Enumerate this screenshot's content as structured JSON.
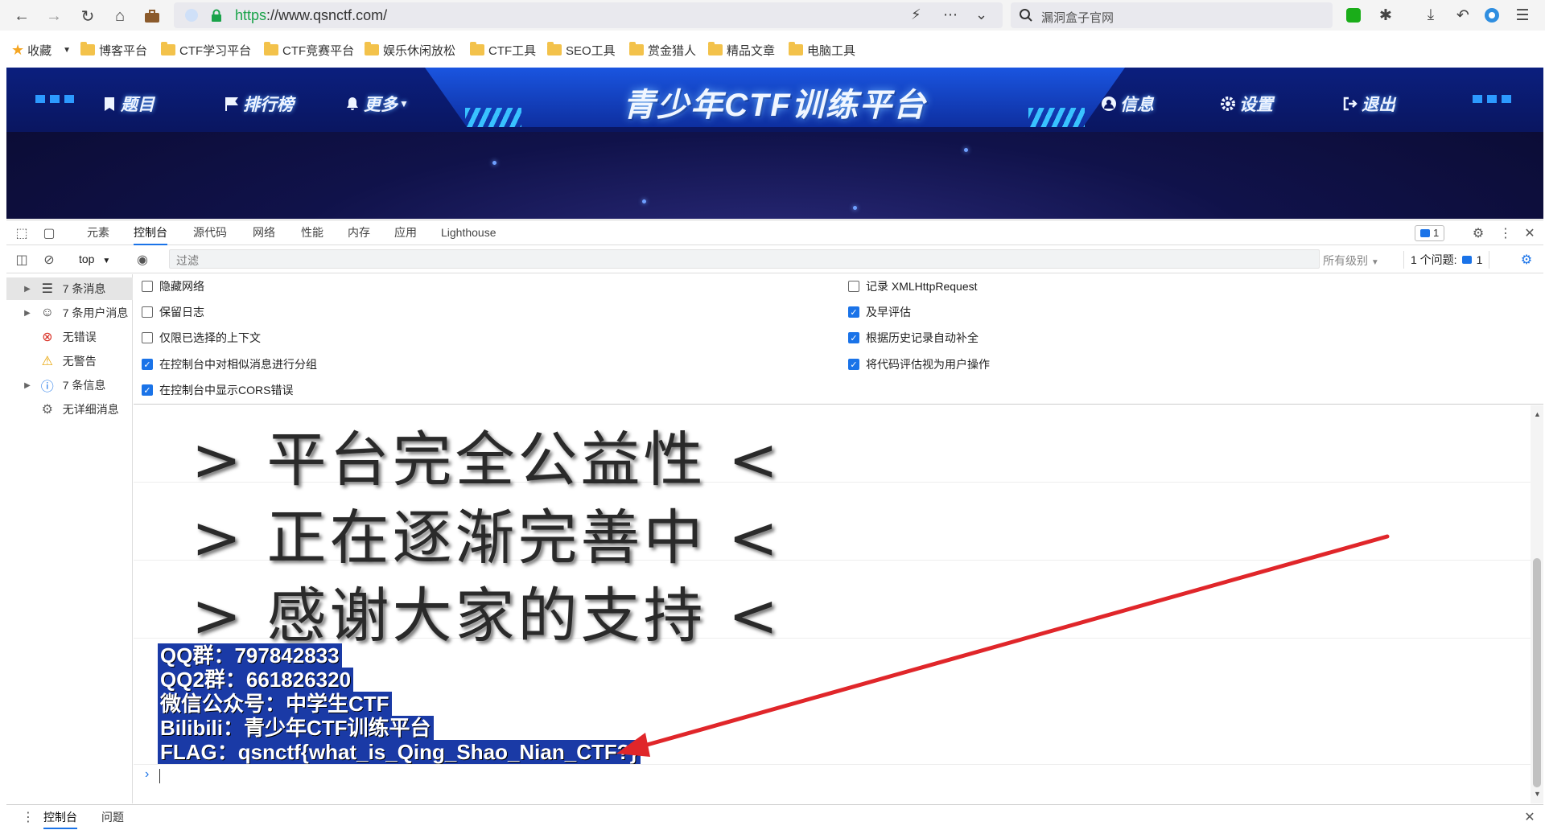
{
  "browser": {
    "url_protocol": "https",
    "url_rest": "://www.qsnctf.com/",
    "search_placeholder": "漏洞盒子官网"
  },
  "bookmarks": {
    "favorites_label": "收藏",
    "items": [
      "博客平台",
      "CTF学习平台",
      "CTF竞赛平台",
      "娱乐休闲放松",
      "CTF工具",
      "SEO工具",
      "赏金猎人",
      "精品文章",
      "电脑工具"
    ]
  },
  "site": {
    "title": "青少年CTF训练平台",
    "nav_left": [
      "题目",
      "排行榜",
      "更多"
    ],
    "nav_right": [
      "信息",
      "设置",
      "退出"
    ]
  },
  "devtools": {
    "tabs": [
      "元素",
      "控制台",
      "源代码",
      "网络",
      "性能",
      "内存",
      "应用",
      "Lighthouse"
    ],
    "active_tab": "控制台",
    "issues_badge": "1",
    "context": "top",
    "filter_placeholder": "过滤",
    "levels_label": "所有级别",
    "issues_label": "1 个问题:",
    "issues_count": "1",
    "sidebar": [
      {
        "label": "7 条消息",
        "icon": "list-icon"
      },
      {
        "label": "7 条用户消息",
        "icon": "user-icon"
      },
      {
        "label": "无错误",
        "icon": "error-icon"
      },
      {
        "label": "无警告",
        "icon": "warning-icon"
      },
      {
        "label": "7 条信息",
        "icon": "info-icon"
      },
      {
        "label": "无详细消息",
        "icon": "bug-icon"
      }
    ],
    "settings_left": [
      {
        "label": "隐藏网络",
        "checked": false
      },
      {
        "label": "保留日志",
        "checked": false
      },
      {
        "label": "仅限已选择的上下文",
        "checked": false
      },
      {
        "label": "在控制台中对相似消息进行分组",
        "checked": true
      },
      {
        "label": "在控制台中显示CORS错误",
        "checked": true
      }
    ],
    "settings_right": [
      {
        "label": "记录 XMLHttpRequest",
        "checked": false
      },
      {
        "label": "及早评估",
        "checked": true
      },
      {
        "label": "根据历史记录自动补全",
        "checked": true
      },
      {
        "label": "将代码评估视为用户操作",
        "checked": true
      }
    ],
    "console_lines": [
      "> 平台完全公益性 <",
      "> 正在逐渐完善中 <",
      "> 感谢大家的支持 <"
    ],
    "info_lines": [
      " QQ群：797842833",
      "QQ2群：661826320",
      "微信公众号：中学生CTF",
      "Bilibili：青少年CTF训练平台",
      "FLAG：qsnctf{what_is_Qing_Shao_Nian_CTF?}"
    ],
    "drawer_tabs": [
      "控制台",
      "问题"
    ]
  },
  "colors": {
    "accent": "#1a73e8",
    "annotation_arrow": "#e0262a",
    "highlight": "#1a3aa6"
  }
}
